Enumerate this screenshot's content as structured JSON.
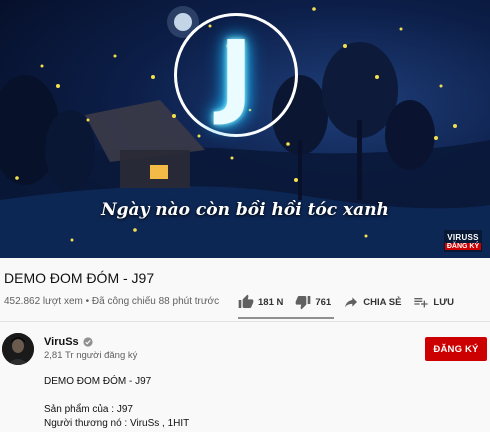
{
  "video": {
    "logo_letter": "J",
    "lyric_text": "Ngày nào còn bồi hồi tóc xanh",
    "watermark_name": "VIRUSS",
    "watermark_subscribe": "ĐĂNG KÝ"
  },
  "title": "DEMO ĐOM ĐÓM - J97",
  "views_text": "452.862 lượt xem • Đã công chiếu 88 phút trước",
  "actions": {
    "like_count": "181 N",
    "dislike_count": "761",
    "share_label": "CHIA SẺ",
    "save_label": "LƯU",
    "like_ratio": 0.996
  },
  "channel": {
    "name": "ViruSs",
    "subscribers": "2,81 Tr người đăng ký",
    "subscribe_label": "ĐĂNG KÝ"
  },
  "description": {
    "line1": "DEMO ĐOM ĐÓM - J97",
    "line2": "Sản phẩm của : J97",
    "line3": "Người thương nó : ViruSs , 1HIT"
  },
  "icons": [
    "like-icon",
    "dislike-icon",
    "share-icon",
    "save-playlist-icon",
    "verified-icon"
  ],
  "colors": {
    "subscribe_red": "#cc0000",
    "logo_glow": "#33ccff",
    "firefly": "#f4e04d"
  }
}
